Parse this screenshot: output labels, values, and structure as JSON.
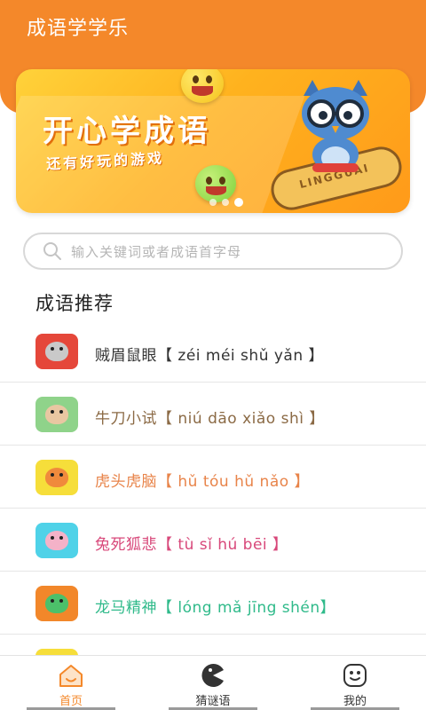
{
  "header": {
    "title": "成语学学乐"
  },
  "banner": {
    "title": "开心学成语",
    "subtitle": "还有好玩的游戏",
    "board_text": "LINGGUAI",
    "slides": 3,
    "active_slide": 3
  },
  "search": {
    "placeholder": "输入关键词或者成语首字母"
  },
  "section": {
    "title": "成语推荐"
  },
  "idioms": [
    {
      "text": "贼眉鼠眼【 zéi méi shǔ yǎn 】",
      "color": "#333333",
      "icon_bg": "#e5473a",
      "face": "#c9c9c9",
      "animal": "mouse"
    },
    {
      "text": "牛刀小试【 niú dāo xiǎo shì 】",
      "color": "#8b6a45",
      "icon_bg": "#8fd38a",
      "face": "#e9c7a2",
      "animal": "ox"
    },
    {
      "text": "虎头虎脑【 hǔ tóu hǔ nǎo 】",
      "color": "#e8844a",
      "icon_bg": "#f6de3a",
      "face": "#f08a3c",
      "animal": "tiger"
    },
    {
      "text": "兔死狐悲【 tù sǐ hú bēi 】",
      "color": "#d8487a",
      "icon_bg": "#4fd2e8",
      "face": "#f4b2c8",
      "animal": "rabbit"
    },
    {
      "text": "龙马精神【 lóng mǎ jīng shén】",
      "color": "#2fba8a",
      "icon_bg": "#f2872a",
      "face": "#4cc06a",
      "animal": "dragon"
    }
  ],
  "nav": {
    "home": "首页",
    "riddle": "猜谜语",
    "mine": "我的",
    "active_color": "#f4882a"
  }
}
